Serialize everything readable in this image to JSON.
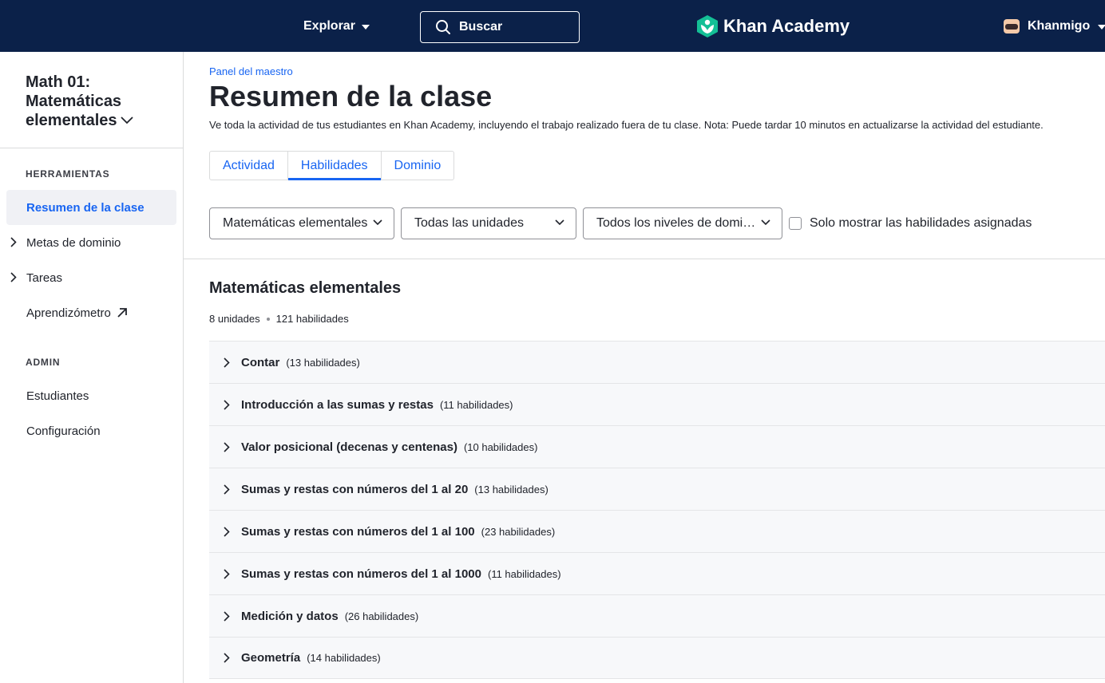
{
  "header": {
    "explore_label": "Explorar",
    "search_label": "Buscar",
    "logo_text": "Khan Academy",
    "khanmigo_label": "Khanmigo",
    "bg_color": "#0b2149",
    "logo_color": "#14bf96"
  },
  "sidebar": {
    "class_title_line1": "Math 01:",
    "class_title_line2": "Matemáticas",
    "class_title_line3": "elementales",
    "tools_heading": "HERRAMIENTAS",
    "items": [
      {
        "label": "Resumen de la clase",
        "active": true
      },
      {
        "label": "Metas de dominio",
        "expandable": true
      },
      {
        "label": "Tareas",
        "expandable": true
      },
      {
        "label": "Aprendizómetro",
        "external": true
      }
    ],
    "admin_heading": "ADMIN",
    "admin_items": [
      {
        "label": "Estudiantes"
      },
      {
        "label": "Configuración"
      }
    ]
  },
  "main": {
    "breadcrumb": "Panel del maestro",
    "title": "Resumen de la clase",
    "description": "Ve toda la actividad de tus estudiantes en Khan Academy, incluyendo el trabajo realizado fuera de tu clase. Nota: Puede tardar 10 minutos en actualizarse la actividad del estudiante.",
    "tabs": [
      {
        "label": "Actividad",
        "active": false
      },
      {
        "label": "Habilidades",
        "active": true
      },
      {
        "label": "Dominio",
        "active": false
      }
    ],
    "filters": {
      "course": "Matemáticas elementales",
      "units": "Todas las unidades",
      "mastery": "Todos los niveles de domi…",
      "assigned_only_label": "Solo mostrar las habilidades asignadas",
      "assigned_only_checked": false
    },
    "section": {
      "title": "Matemáticas elementales",
      "units_count": "8 unidades",
      "skills_count": "121 habilidades"
    },
    "units": [
      {
        "name": "Contar",
        "count": "(13 habilidades)"
      },
      {
        "name": "Introducción a las sumas y restas",
        "count": "(11 habilidades)"
      },
      {
        "name": "Valor posicional (decenas y centenas)",
        "count": "(10 habilidades)"
      },
      {
        "name": "Sumas y restas con números del 1 al 20",
        "count": "(13 habilidades)"
      },
      {
        "name": "Sumas y restas con números del 1 al 100",
        "count": "(23 habilidades)"
      },
      {
        "name": "Sumas y restas con números del 1 al 1000",
        "count": "(11 habilidades)"
      },
      {
        "name": "Medición y datos",
        "count": "(26 habilidades)"
      },
      {
        "name": "Geometría",
        "count": "(14 habilidades)"
      }
    ],
    "accent_color": "#1865f2"
  }
}
